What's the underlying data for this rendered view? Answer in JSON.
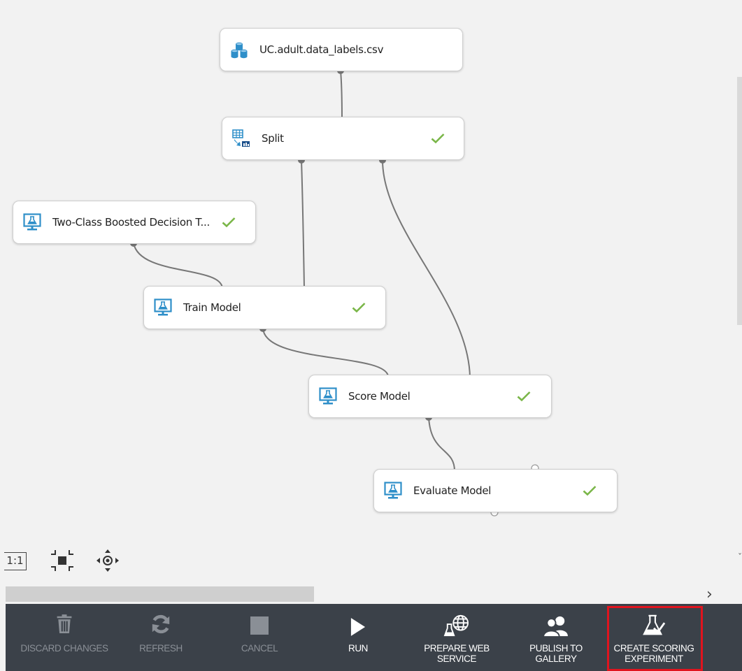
{
  "colors": {
    "canvas_bg": "#f2f2f2",
    "toolbar_bg": "#3b4149",
    "check_green": "#7ab648",
    "module_icon_blue": "#2f8fc9",
    "highlight_red": "#e0141e",
    "disabled_text": "#8a8f96"
  },
  "modules": {
    "dataset": {
      "label": "UC.adult.data_labels.csv",
      "icon": "dataset-icon",
      "status": ""
    },
    "split": {
      "label": "Split",
      "icon": "split-data-icon",
      "status": "completed"
    },
    "boosted": {
      "label": "Two-Class Boosted Decision T...",
      "icon": "ml-module-icon",
      "status": "completed"
    },
    "train": {
      "label": "Train Model",
      "icon": "ml-module-icon",
      "status": "completed"
    },
    "score": {
      "label": "Score Model",
      "icon": "ml-module-icon",
      "status": "completed"
    },
    "evaluate": {
      "label": "Evaluate Model",
      "icon": "ml-module-icon",
      "status": "completed"
    }
  },
  "zoom_tools": {
    "actual_size": "1:1",
    "fit_icon": "fit-to-screen-icon",
    "pan_icon": "pan-icon"
  },
  "scrollbar": {
    "right_arrow": "›"
  },
  "toolbar": {
    "discard": {
      "label_line1": "DISCARD CHANGES",
      "label_line2": "",
      "icon": "trash-icon",
      "enabled": false
    },
    "refresh": {
      "label_line1": "REFRESH",
      "label_line2": "",
      "icon": "refresh-icon",
      "enabled": false
    },
    "cancel": {
      "label_line1": "CANCEL",
      "label_line2": "",
      "icon": "stop-icon",
      "enabled": false
    },
    "run": {
      "label_line1": "RUN",
      "label_line2": "",
      "icon": "play-icon",
      "enabled": true
    },
    "prepare": {
      "label_line1": "PREPARE WEB",
      "label_line2": "SERVICE",
      "icon": "web-service-icon",
      "enabled": true
    },
    "publish": {
      "label_line1": "PUBLISH TO",
      "label_line2": "GALLERY",
      "icon": "users-icon",
      "enabled": true
    },
    "scoring": {
      "label_line1": "CREATE SCORING",
      "label_line2": "EXPERIMENT",
      "icon": "scoring-flask-icon",
      "enabled": true,
      "highlighted": true
    }
  }
}
